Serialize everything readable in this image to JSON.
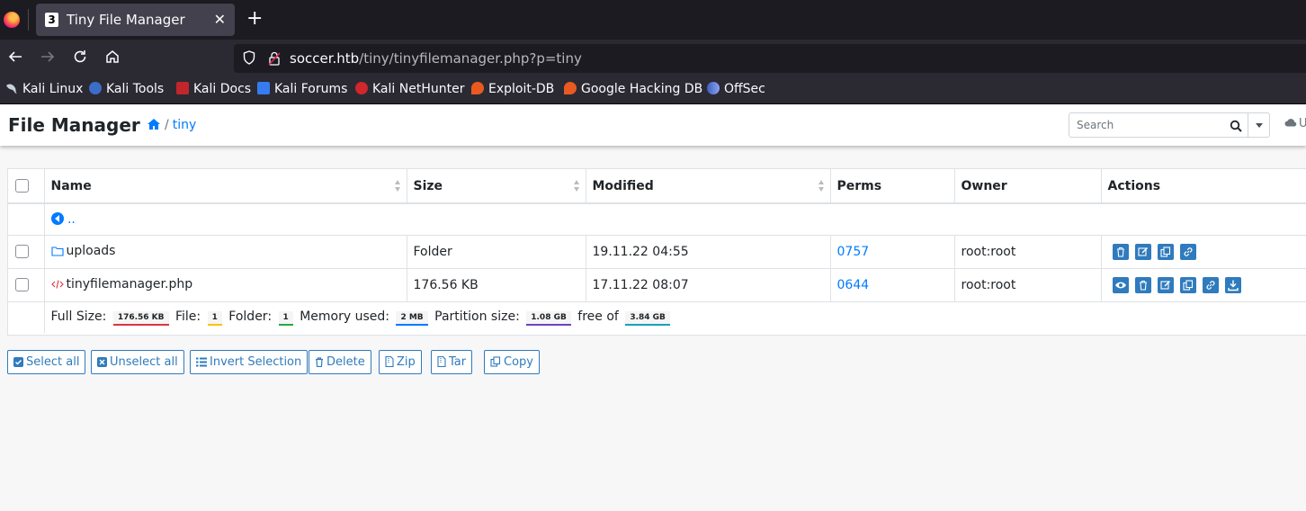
{
  "browser": {
    "tab_title": "Tiny File Manager",
    "tab_favicon_letter": "3",
    "tab_close": "✕",
    "new_tab": "+",
    "url_host": "soccer.htb",
    "url_path": "/tiny/tinyfilemanager.php?p=tiny",
    "bookmarks": [
      {
        "label": "Kali Linux",
        "icon": "kali-dragon-icon",
        "color": "#c9d1d9"
      },
      {
        "label": "Kali Tools",
        "icon": "kali-tools-icon",
        "color": "#3a6ec9"
      },
      {
        "label": "Kali Docs",
        "icon": "kali-docs-icon",
        "color": "#c0262c"
      },
      {
        "label": "Kali Forums",
        "icon": "kali-forums-icon",
        "color": "#367bf0"
      },
      {
        "label": "Kali NetHunter",
        "icon": "nethunter-icon",
        "color": "#d0262c"
      },
      {
        "label": "Exploit-DB",
        "icon": "exploit-db-icon",
        "color": "#ea5a20"
      },
      {
        "label": "Google Hacking DB",
        "icon": "ghdb-icon",
        "color": "#ea5a20"
      },
      {
        "label": "OffSec",
        "icon": "offsec-icon",
        "color": "#5a7bd6"
      }
    ]
  },
  "header": {
    "title": "File Manager",
    "breadcrumb": "tiny",
    "search_placeholder": "Search",
    "upload_label": "U"
  },
  "table": {
    "columns": [
      "Name",
      "Size",
      "Modified",
      "Perms",
      "Owner",
      "Actions"
    ],
    "parent_link": "..",
    "rows": [
      {
        "name": "uploads",
        "type": "folder",
        "size": "Folder",
        "modified": "19.11.22 04:55",
        "perms": "0757",
        "owner": "root:root"
      },
      {
        "name": "tinyfilemanager.php",
        "type": "php",
        "size": "176.56 KB",
        "modified": "17.11.22 08:07",
        "perms": "0644",
        "owner": "root:root"
      }
    ],
    "footer": {
      "full_size_label": "Full Size:",
      "full_size": "176.56 KB",
      "file_label": "File:",
      "file_count": "1",
      "folder_label": "Folder:",
      "folder_count": "1",
      "memory_label": "Memory used:",
      "memory": "2 MB",
      "partition_label": "Partition size:",
      "partition": "1.08 GB",
      "free_label": "free of",
      "total": "3.84 GB"
    },
    "colors": {
      "full_size": "#dc3545",
      "file": "#ffc107",
      "folder": "#28a745",
      "memory": "#007bff",
      "partition": "#6f42c1",
      "total": "#17a2b8"
    }
  },
  "buttons": {
    "select_all": "Select all",
    "unselect_all": "Unselect all",
    "invert_selection": "Invert Selection",
    "delete": "Delete",
    "zip": "Zip",
    "tar": "Tar",
    "copy": "Copy"
  }
}
